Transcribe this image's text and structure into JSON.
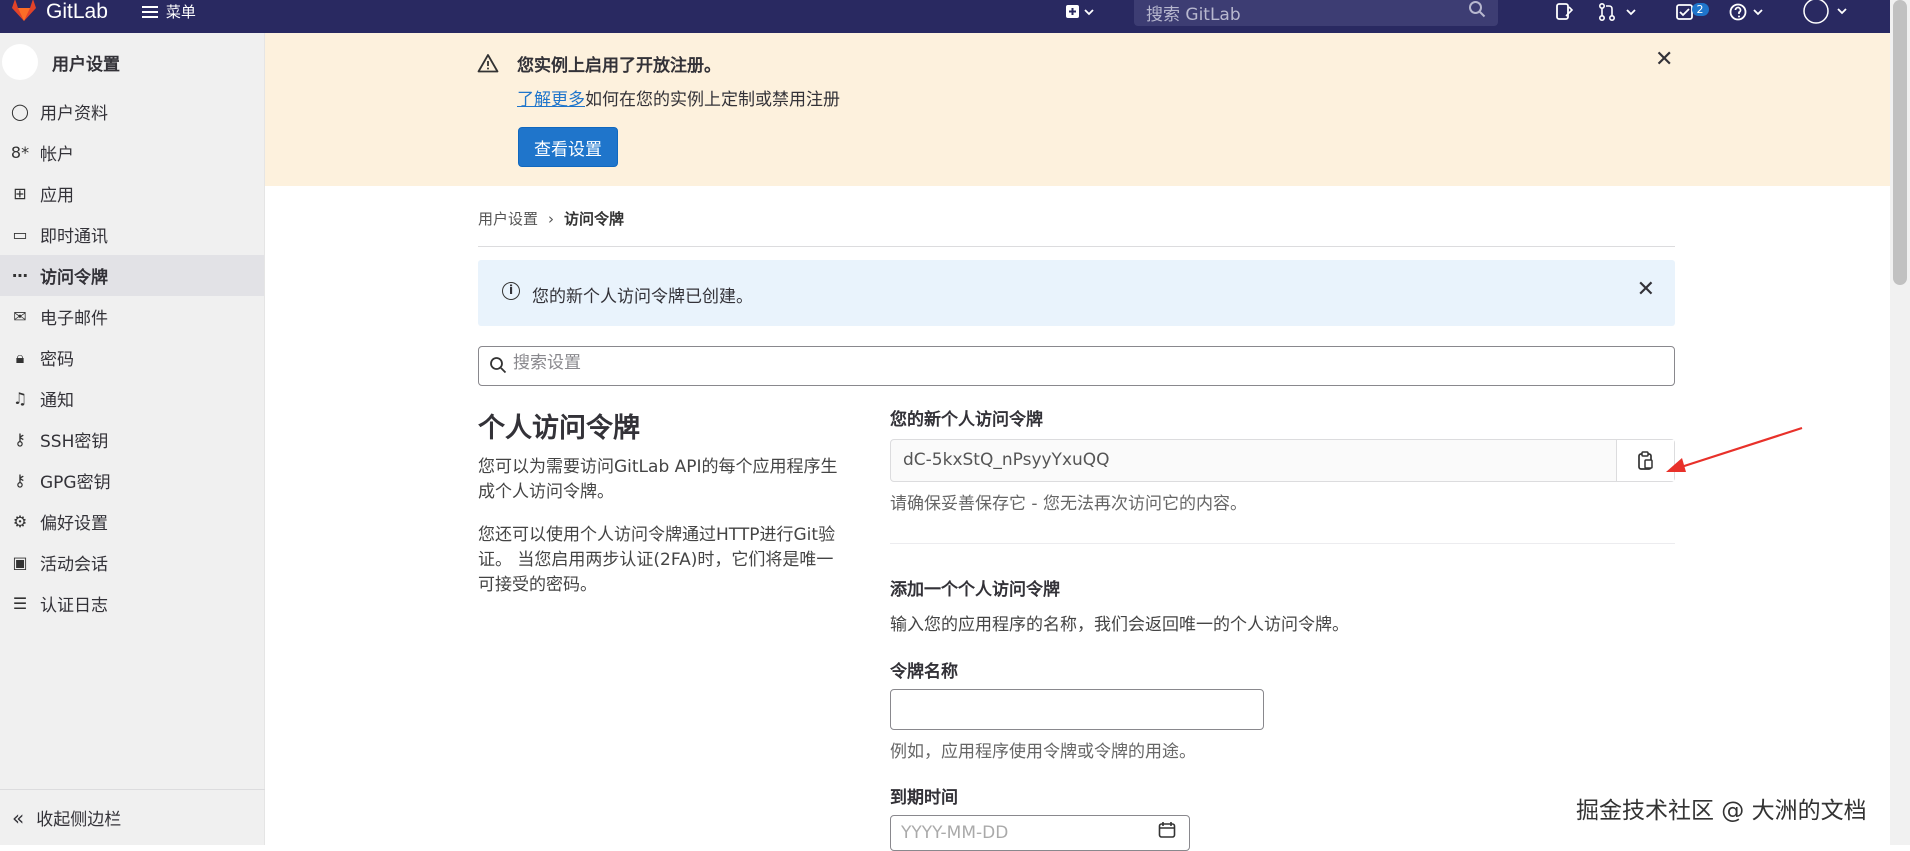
{
  "topbar": {
    "brand": "GitLab",
    "menu_label": "菜单",
    "search_placeholder": "搜索 GitLab",
    "todo_count": "2"
  },
  "sidebar": {
    "title": "用户设置",
    "items": [
      {
        "label": "用户资料",
        "icon": "user-icon"
      },
      {
        "label": "帐户",
        "icon": "account-icon"
      },
      {
        "label": "应用",
        "icon": "applications-icon"
      },
      {
        "label": "即时通讯",
        "icon": "chat-icon"
      },
      {
        "label": "访问令牌",
        "icon": "token-icon",
        "active": true
      },
      {
        "label": "电子邮件",
        "icon": "mail-icon"
      },
      {
        "label": "密码",
        "icon": "lock-icon"
      },
      {
        "label": "通知",
        "icon": "bell-icon"
      },
      {
        "label": "SSH密钥",
        "icon": "key-icon"
      },
      {
        "label": "GPG密钥",
        "icon": "key-icon"
      },
      {
        "label": "偏好设置",
        "icon": "preferences-icon"
      },
      {
        "label": "活动会话",
        "icon": "monitor-icon"
      },
      {
        "label": "认证日志",
        "icon": "log-icon"
      }
    ],
    "collapse_label": "收起侧边栏"
  },
  "banner": {
    "title": "您实例上启用了开放注册。",
    "link_text": "了解更多",
    "desc_rest": "如何在您的实例上定制或禁用注册",
    "button_label": "查看设置"
  },
  "breadcrumb": {
    "parent": "用户设置",
    "current": "访问令牌"
  },
  "alert": {
    "text": "您的新个人访问令牌已创建。"
  },
  "search": {
    "placeholder": "搜索设置"
  },
  "left": {
    "heading": "个人访问令牌",
    "para1": "您可以为需要访问GitLab API的每个应用程序生成个人访问令牌。",
    "para2": "您还可以使用个人访问令牌通过HTTP进行Git验证。 当您启用两步认证(2FA)时，它们将是唯一可接受的密码。"
  },
  "token": {
    "label": "您的新个人访问令牌",
    "value": "dC-5kxStQ_nPsyyYxuQQ",
    "help": "请确保妥善保存它 - 您无法再次访问它的内容。"
  },
  "add": {
    "heading": "添加一个个人访问令牌",
    "desc": "输入您的应用程序的名称，我们会返回唯一的个人访问令牌。",
    "name_label": "令牌名称",
    "name_help": "例如，应用程序使用令牌或令牌的用途。",
    "expire_label": "到期时间",
    "expire_placeholder": "YYYY-MM-DD"
  },
  "watermark": "掘金技术社区 @ 大洲的文档",
  "colors": {
    "topbar": "#292961",
    "banner": "#fdf1dd",
    "alert": "#e9f3fc",
    "primary": "#1f75cb",
    "annotation_arrow": "#e8312a"
  }
}
